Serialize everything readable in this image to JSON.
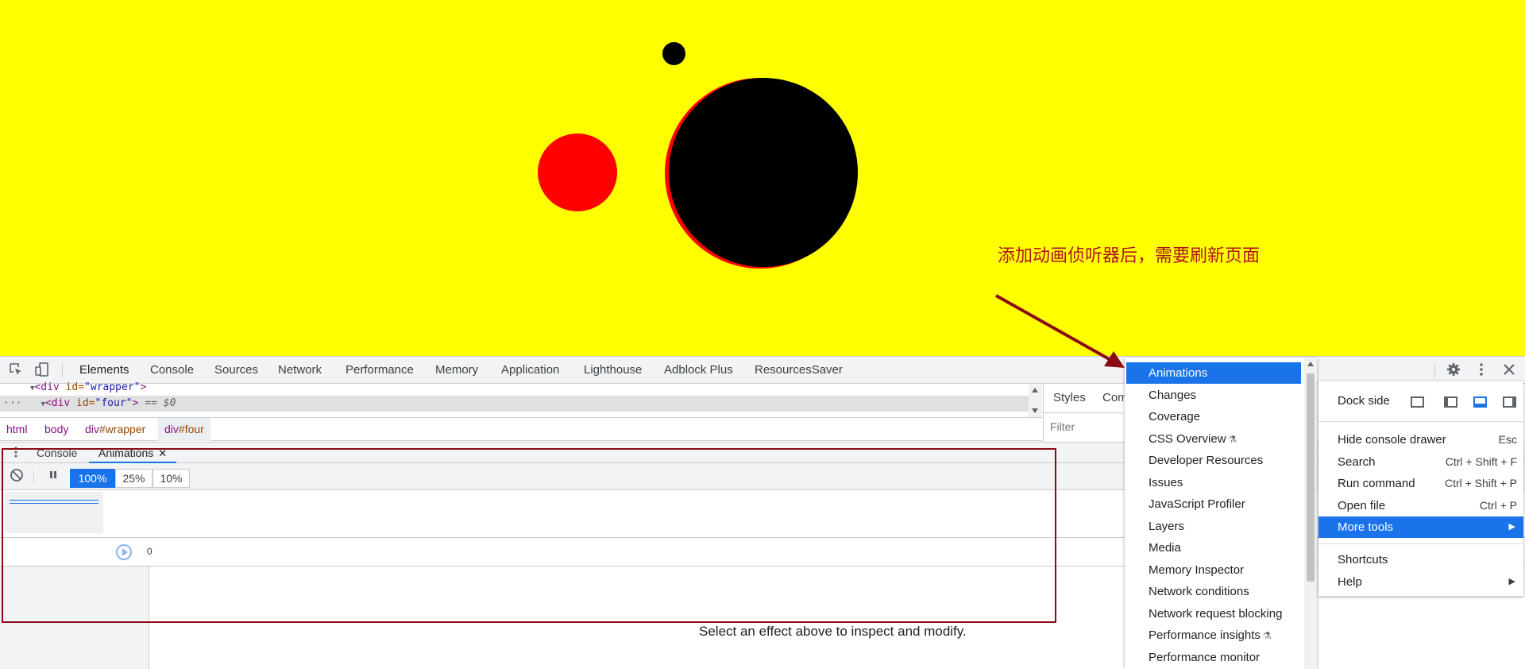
{
  "viewport": {
    "annotation": "添加动画侦听器后，需要刷新页面",
    "colors": {
      "background": "#ffff00",
      "black_circle": "#000000",
      "red_circle": "#ff0000"
    }
  },
  "devtools": {
    "tabs": [
      {
        "label": "Elements",
        "active": true
      },
      {
        "label": "Console"
      },
      {
        "label": "Sources"
      },
      {
        "label": "Network"
      },
      {
        "label": "Performance"
      },
      {
        "label": "Memory"
      },
      {
        "label": "Application"
      },
      {
        "label": "Lighthouse"
      },
      {
        "label": "Adblock Plus"
      },
      {
        "label": "ResourcesSaver"
      }
    ],
    "dom_tree": {
      "line1": {
        "open": "<",
        "tag": "div",
        "attr": " id=",
        "value": "\"wrapper\"",
        "close": ">"
      },
      "line2": {
        "open": "<",
        "tag": "div",
        "attr": " id=",
        "value": "\"four\"",
        "close": ">",
        "selected_marker": "== $0"
      }
    },
    "breadcrumbs": [
      {
        "tag": "html",
        "id": ""
      },
      {
        "tag": "body",
        "id": ""
      },
      {
        "tag": "div",
        "id": "#wrapper"
      },
      {
        "tag": "div",
        "id": "#four"
      }
    ],
    "styles_pane": {
      "tabs": [
        "Styles",
        "Com"
      ],
      "filter_placeholder": "Filter"
    },
    "drawer": {
      "tabs": [
        {
          "label": "Console"
        },
        {
          "label": "Animations",
          "active": true
        }
      ],
      "playback_rates": [
        "100%",
        "25%",
        "10%"
      ],
      "active_rate": "100%",
      "timeline_zero": "0",
      "empty_message": "Select an effect above to inspect and modify."
    }
  },
  "more_tools_menu": {
    "items": [
      {
        "label": "Animations",
        "highlighted": true
      },
      {
        "label": "Changes"
      },
      {
        "label": "Coverage"
      },
      {
        "label": "CSS Overview",
        "experimental": true
      },
      {
        "label": "Developer Resources"
      },
      {
        "label": "Issues"
      },
      {
        "label": "JavaScript Profiler"
      },
      {
        "label": "Layers"
      },
      {
        "label": "Media"
      },
      {
        "label": "Memory Inspector"
      },
      {
        "label": "Network conditions"
      },
      {
        "label": "Network request blocking"
      },
      {
        "label": "Performance insights",
        "experimental": true
      },
      {
        "label": "Performance monitor"
      }
    ]
  },
  "main_menu": {
    "dock_side_label": "Dock side",
    "items": [
      {
        "label": "Hide console drawer",
        "shortcut": "Esc"
      },
      {
        "label": "Search",
        "shortcut": "Ctrl + Shift + F"
      },
      {
        "label": "Run command",
        "shortcut": "Ctrl + Shift + P"
      },
      {
        "label": "Open file",
        "shortcut": "Ctrl + P"
      },
      {
        "label": "More tools",
        "shortcut": "",
        "highlighted": true,
        "submenu": true
      }
    ],
    "footer_items": [
      {
        "label": "Shortcuts"
      },
      {
        "label": "Help",
        "submenu": true
      }
    ]
  },
  "theme": {
    "accent": "#1a73e8",
    "annotation_color": "#8b0a14"
  }
}
